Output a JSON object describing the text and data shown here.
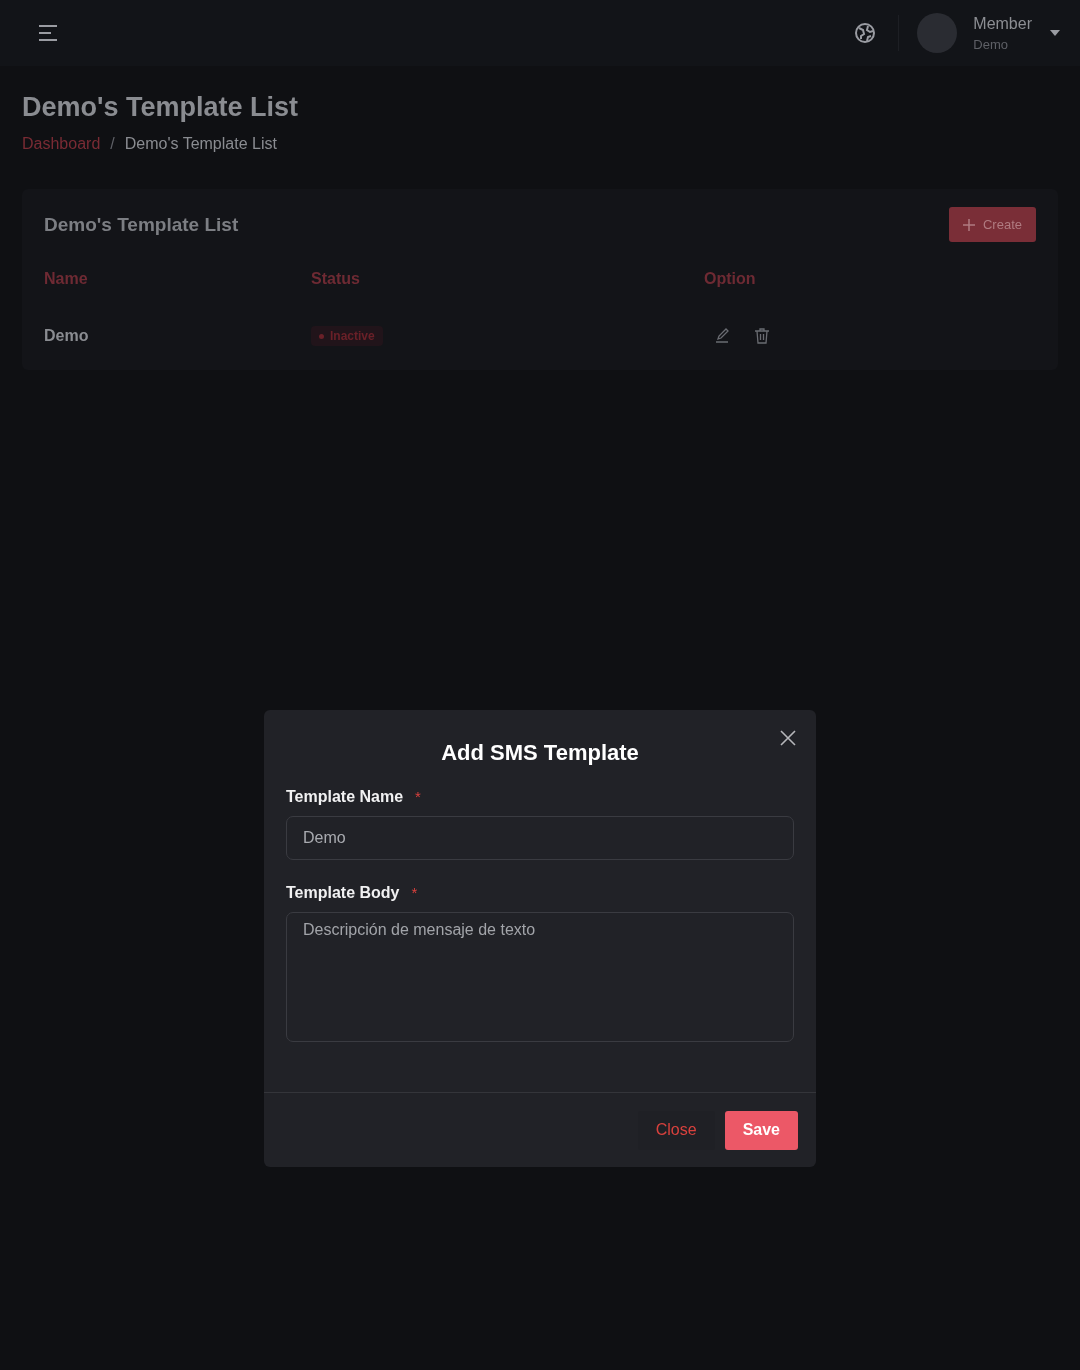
{
  "header": {
    "user": {
      "name": "Member",
      "role": "Demo"
    }
  },
  "page": {
    "title": "Demo's Template List",
    "breadcrumb_separator": "/",
    "breadcrumb": [
      {
        "label": "Dashboard",
        "kind": "link"
      },
      {
        "label": "Demo's Template List",
        "kind": "current"
      }
    ]
  },
  "card": {
    "title": "Demo's Template List",
    "create_button": "Create",
    "table": {
      "columns": [
        "Name",
        "Status",
        "Option"
      ],
      "rows": [
        {
          "name": "Demo",
          "status": {
            "label": "Inactive",
            "active": false
          }
        }
      ]
    }
  },
  "modal": {
    "title": "Add SMS Template",
    "fields": [
      {
        "kind": "input",
        "label": "Template Name",
        "required_mark": "*",
        "value": "Demo"
      },
      {
        "kind": "textarea",
        "label": "Template Body",
        "required_mark": "*",
        "placeholder": "Descripción de mensaje de texto"
      }
    ],
    "buttons": [
      {
        "label": "Close",
        "kind": "secondary"
      },
      {
        "label": "Save",
        "kind": "primary"
      }
    ]
  }
}
